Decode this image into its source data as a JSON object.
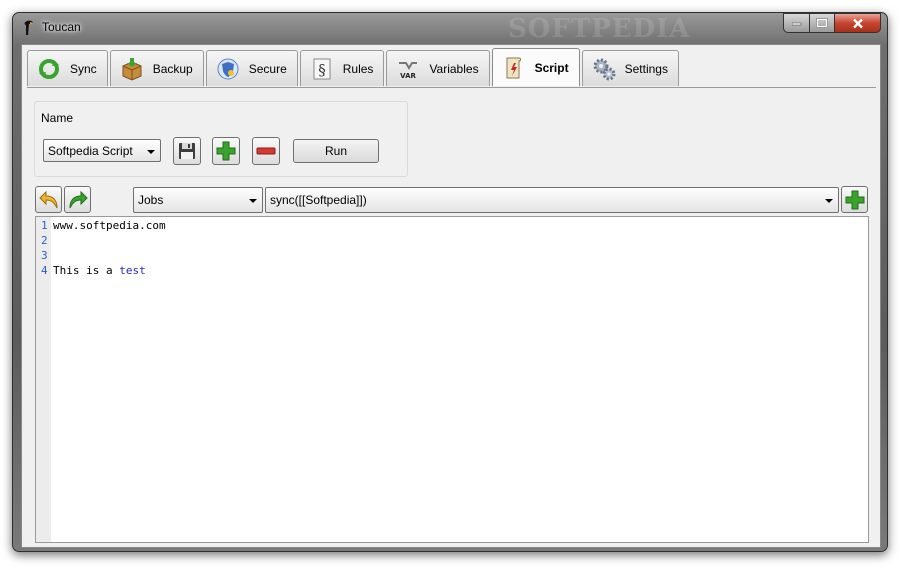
{
  "window": {
    "title": "Toucan",
    "watermark": "SOFTPEDIA",
    "buttons": [
      "minimize",
      "maximize",
      "close"
    ]
  },
  "tabs": [
    {
      "label": "Sync",
      "icon": "sync-icon"
    },
    {
      "label": "Backup",
      "icon": "backup-box-icon"
    },
    {
      "label": "Secure",
      "icon": "secure-shield-icon"
    },
    {
      "label": "Rules",
      "icon": "rules-section-icon"
    },
    {
      "label": "Variables",
      "icon": "variables-icon"
    },
    {
      "label": "Script",
      "icon": "script-icon",
      "active": true
    },
    {
      "label": "Settings",
      "icon": "settings-gears-icon"
    }
  ],
  "name_panel": {
    "label": "Name",
    "script_select": "Softpedia Script",
    "run_label": "Run"
  },
  "toolbar": {
    "category_select": "Jobs",
    "command_select": "sync([[Softpedia]])"
  },
  "editor": {
    "line_numbers": [
      "1",
      "2",
      "3",
      "4"
    ],
    "line1": "www.softpedia.com",
    "line4_plain": "This is a ",
    "line4_keyword": "test"
  },
  "colors": {
    "frame": "#5b5b5b",
    "client": "#f0f0f0",
    "close_button": "#c7452f",
    "add_green": "#3aa32e",
    "remove_red": "#d23a32",
    "line_number_blue": "#2b5fd0",
    "keyword_blue": "#1d2bc4"
  }
}
